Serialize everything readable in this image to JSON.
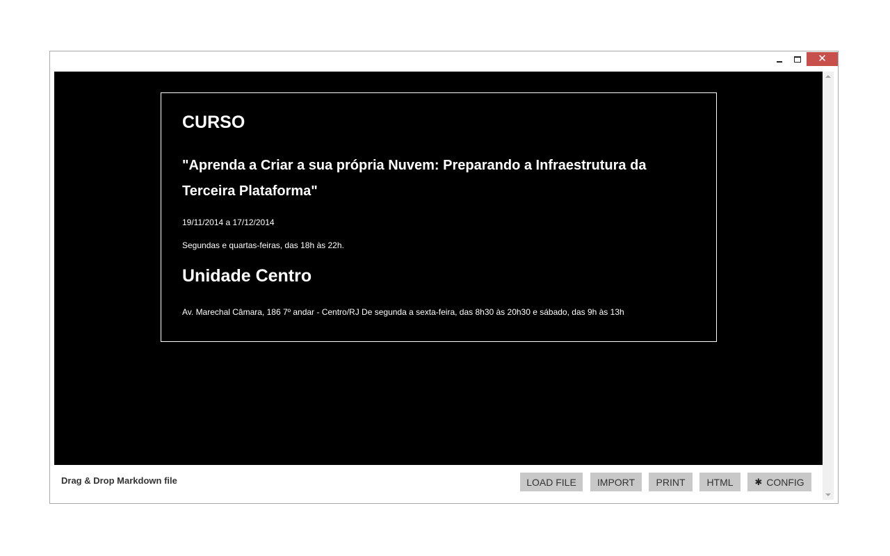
{
  "window": {
    "controls": {
      "minimize_icon": "minimize-icon",
      "maximize_icon": "maximize-icon",
      "close_label": "✕"
    }
  },
  "document": {
    "heading": "CURSO",
    "subtitle": "\"Aprenda a Criar a sua própria Nuvem: Preparando a Infraestrutura da Terceira Plataforma\"",
    "dates": "19/11/2014 a 17/12/2014",
    "schedule": "Segundas e quartas-feiras, das 18h às 22h.",
    "location_heading": "Unidade Centro",
    "address": "Av. Marechal Câmara, 186 7º andar - Centro/RJ De segunda a sexta-feira, das 8h30 às 20h30 e sábado, das 9h às 13h"
  },
  "footer": {
    "drop_hint": "Drag & Drop Markdown file",
    "buttons": {
      "load_file": "LOAD FILE",
      "import": "IMPORT",
      "print": "PRINT",
      "html": "HTML",
      "config_icon": "✱",
      "config": "CONFIG"
    }
  },
  "colors": {
    "close_button": "#c7504d",
    "content_background": "#000000",
    "button_background": "#c8c8c8"
  }
}
